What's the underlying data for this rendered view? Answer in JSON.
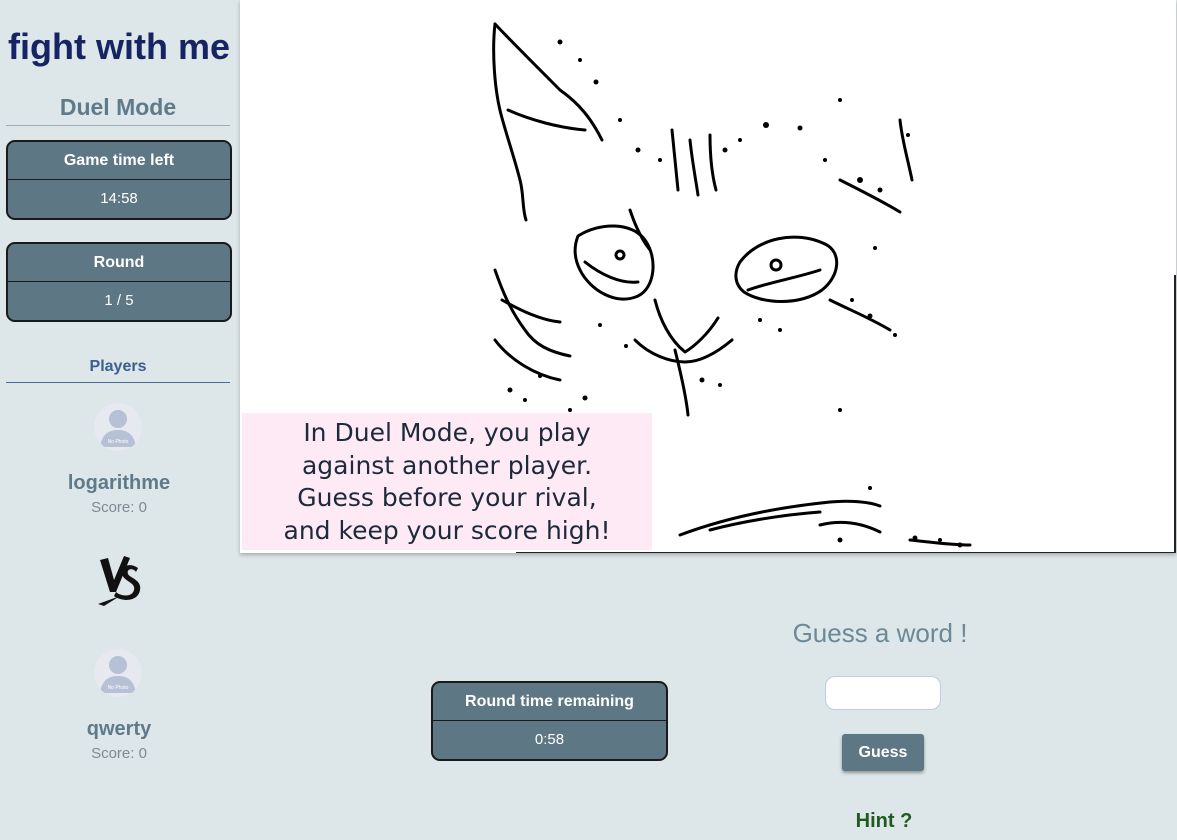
{
  "app": {
    "title": "fight with me",
    "mode_title": "Duel Mode"
  },
  "game_time": {
    "label": "Game time left",
    "value": "14:58"
  },
  "round": {
    "label": "Round",
    "value": "1 / 5"
  },
  "players": {
    "label": "Players",
    "list": [
      {
        "name": "logarithme",
        "score": "Score: 0",
        "avatar_text": "No Photo"
      },
      {
        "name": "qwerty",
        "score": "Score: 0",
        "avatar_text": "No Photo"
      }
    ],
    "vs_text": "VS"
  },
  "drawing": {
    "info_lines": [
      "In Duel Mode, you play",
      "against another player.",
      "Guess before your rival,",
      "and keep your score high!"
    ]
  },
  "round_timer": {
    "label": "Round time remaining",
    "value": "0:58"
  },
  "guess": {
    "title": "Guess a word !",
    "input_value": "",
    "button_label": "Guess",
    "hint_label": "Hint ?"
  },
  "colors": {
    "background": "#dde6e8",
    "title": "#162463",
    "panel": "#5e7784",
    "hint": "#1f5a1f",
    "info_bg": "#fdeaf4"
  }
}
